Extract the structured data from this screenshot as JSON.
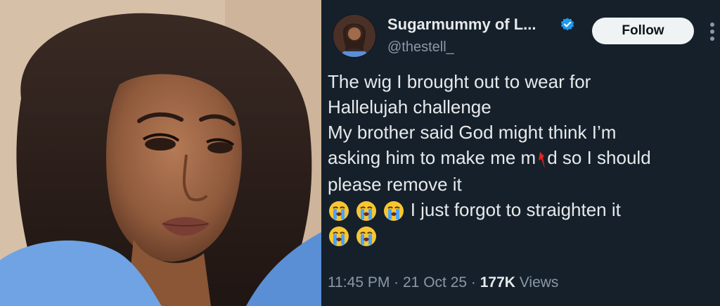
{
  "profile": {
    "name": "Sugarmummy of L...",
    "handle": "@thestell_",
    "follow_label": "Follow"
  },
  "tweet": {
    "lines": [
      "The wig I brought out to wear for",
      "Hallelujah challenge",
      "My brother said God might think I’m",
      "asking him to make me m",
      "d so I should",
      "please remove it",
      "I just forgot to straighten it"
    ]
  },
  "meta": {
    "time": "11:45 PM",
    "sep1": " · ",
    "date": "21 Oct 25",
    "sep2": " · ",
    "views_count": "177K",
    "views_label": " Views"
  },
  "icons": {
    "verified": "verified-badge-icon",
    "crying": "loudly-crying-face-icon",
    "more": "more-options-icon"
  },
  "colors": {
    "tweet_bg": "#15202b",
    "text": "#e7e9ea",
    "muted": "#8b98a5",
    "verified": "#1d9bf0",
    "follow_bg": "#eff3f4"
  }
}
